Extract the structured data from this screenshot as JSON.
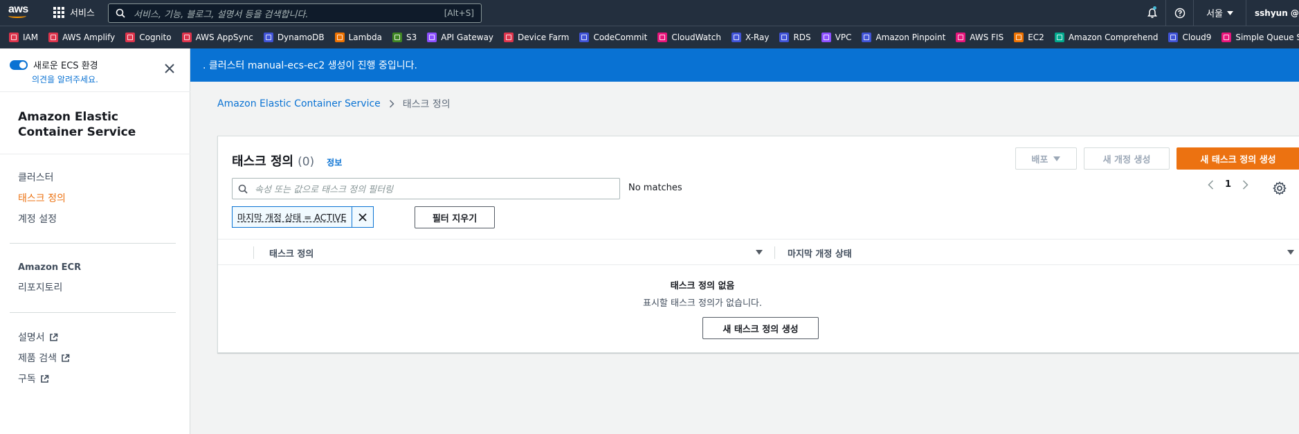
{
  "topnav": {
    "logo": "aws",
    "services_label": "서비스",
    "search_placeholder": "서비스, 기능, 블로그, 설명서 등을 검색합니다.",
    "search_shortcut": "[Alt+S]",
    "region": "서울",
    "user": "sshyun @ s"
  },
  "favorites": [
    {
      "label": "IAM",
      "color": "#dd344c"
    },
    {
      "label": "AWS Amplify",
      "color": "#dd344c"
    },
    {
      "label": "Cognito",
      "color": "#dd344c"
    },
    {
      "label": "AWS AppSync",
      "color": "#dd344c"
    },
    {
      "label": "DynamoDB",
      "color": "#4053d6"
    },
    {
      "label": "Lambda",
      "color": "#ed7100"
    },
    {
      "label": "S3",
      "color": "#3f8624"
    },
    {
      "label": "API Gateway",
      "color": "#8c4fff"
    },
    {
      "label": "Device Farm",
      "color": "#dd344c"
    },
    {
      "label": "CodeCommit",
      "color": "#4053d6"
    },
    {
      "label": "CloudWatch",
      "color": "#e7157b"
    },
    {
      "label": "X-Ray",
      "color": "#4053d6"
    },
    {
      "label": "RDS",
      "color": "#4053d6"
    },
    {
      "label": "VPC",
      "color": "#8c4fff"
    },
    {
      "label": "Amazon Pinpoint",
      "color": "#4053d6"
    },
    {
      "label": "AWS FIS",
      "color": "#e7157b"
    },
    {
      "label": "EC2",
      "color": "#ed7100"
    },
    {
      "label": "Amazon Comprehend",
      "color": "#01a88d"
    },
    {
      "label": "Cloud9",
      "color": "#4053d6"
    },
    {
      "label": "Simple Queue Servic",
      "color": "#e7157b"
    }
  ],
  "sidebar": {
    "toggle_label": "새로운 ECS 환경",
    "feedback": "의견을 알려주세요.",
    "title": "Amazon Elastic Container Service",
    "nav": [
      "클러스터",
      "태스크 정의",
      "계정 설정"
    ],
    "ecr_heading": "Amazon ECR",
    "ecr_item": "리포지토리",
    "links": [
      "설명서",
      "제품 검색",
      "구독"
    ]
  },
  "flash": {
    "message": ". 클러스터 manual-ecs-ec2 생성이 진행 중입니다."
  },
  "breadcrumb": {
    "root": "Amazon Elastic Container Service",
    "current": "태스크 정의"
  },
  "panel": {
    "title": "태스크 정의",
    "count": "(0)",
    "info": "정보",
    "deploy_btn": "배포",
    "new_revision_btn": "새 개정 생성",
    "create_btn": "새 태스크 정의 생성",
    "filter_placeholder": "속성 또는 값으로 태스크 정의 필터링",
    "no_matches": "No matches",
    "page": "1",
    "token": "마지막 개정 상태 = ACTIVE",
    "clear_filters": "필터 지우기",
    "columns": [
      "태스크 정의",
      "마지막 개정 상태"
    ],
    "empty_title": "태스크 정의 없음",
    "empty_sub": "표시할 태스크 정의가 없습니다.",
    "empty_btn": "새 태스크 정의 생성"
  }
}
